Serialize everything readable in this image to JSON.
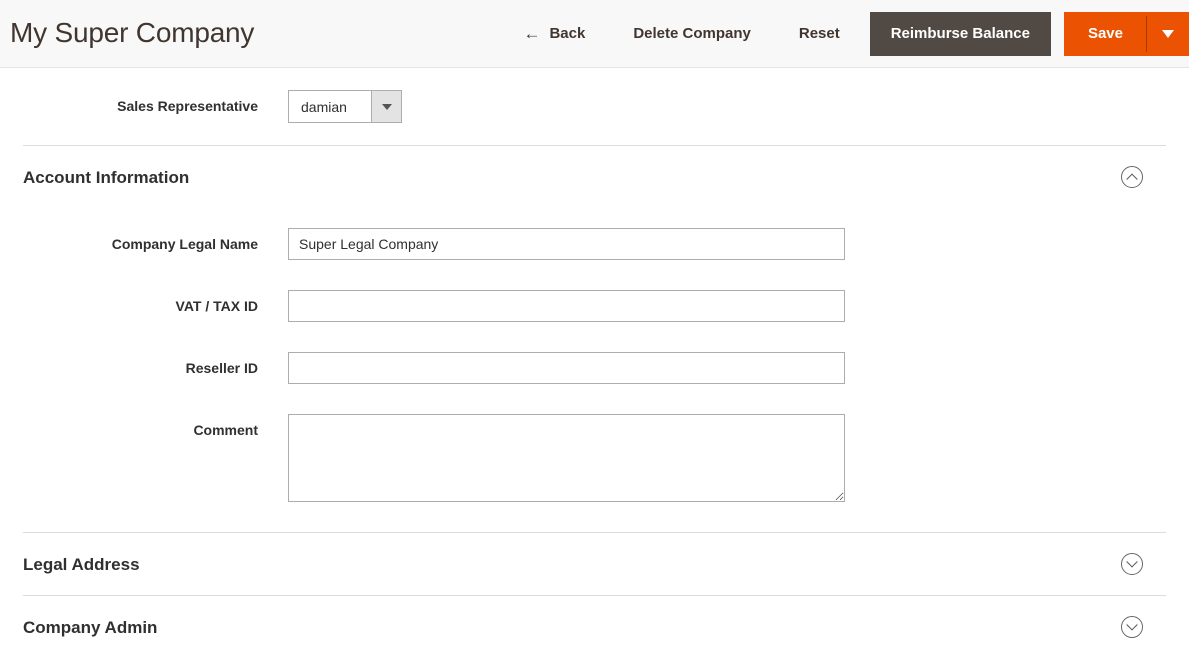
{
  "header": {
    "title": "My Super Company",
    "back_label": "Back",
    "back_icon": "arrow-left-icon",
    "delete_label": "Delete Company",
    "reset_label": "Reset",
    "reimburse_label": "Reimburse Balance",
    "save_label": "Save",
    "save_toggle_icon": "caret-down-icon",
    "colors": {
      "primary": "#eb5202",
      "secondary": "#514943",
      "header_bg": "#f8f8f8",
      "title_color": "#41362f"
    }
  },
  "top_field": {
    "label": "Sales Representative",
    "select_value": "damian",
    "select_icon": "caret-down-icon"
  },
  "sections": [
    {
      "id": "account-information",
      "title": "Account Information",
      "expanded": true,
      "icon": "chevron-up-circle-icon",
      "fields": [
        {
          "label": "Company Legal Name",
          "type": "text",
          "value": "Super Legal Company",
          "placeholder": ""
        },
        {
          "label": "VAT / TAX ID",
          "type": "text",
          "value": "",
          "placeholder": ""
        },
        {
          "label": "Reseller ID",
          "type": "text",
          "value": "",
          "placeholder": ""
        },
        {
          "label": "Comment",
          "type": "textarea",
          "value": "",
          "placeholder": ""
        }
      ]
    },
    {
      "id": "legal-address",
      "title": "Legal Address",
      "expanded": false,
      "icon": "chevron-down-circle-icon",
      "fields": []
    },
    {
      "id": "company-admin",
      "title": "Company Admin",
      "expanded": false,
      "icon": "chevron-down-circle-icon",
      "fields": []
    }
  ]
}
